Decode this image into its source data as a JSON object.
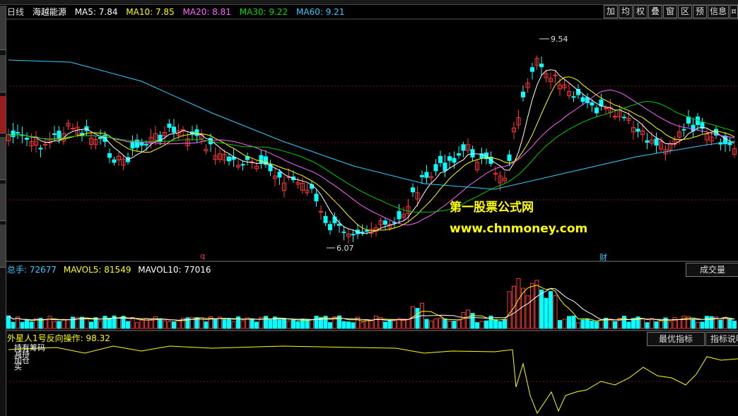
{
  "header": {
    "period": "日线",
    "stock_name": "海越能源",
    "ma5": "MA5: 7.84",
    "ma10": "MA10: 7.85",
    "ma20": "MA20: 8.81",
    "ma30": "MA30: 9.22",
    "ma60": "MA60: 9.21"
  },
  "toolbar_buttons": [
    "加",
    "均",
    "权",
    "叠",
    "窗",
    "区",
    "预",
    "信息",
    "¤"
  ],
  "price_panel": {
    "high_label": "9.54",
    "low_label": "6.07",
    "marker_q": "q",
    "marker_cai": "财",
    "watermark_cn": "第一股票公式网",
    "watermark_url": "www.chnmoney.com"
  },
  "volume_panel": {
    "total": "总手: 72677",
    "mavol5": "MAVOL5: 81549",
    "mavol10": "MAVOL10: 77016",
    "button": "成交量"
  },
  "indicator_panel": {
    "title": "外星人1号反向操作: 98.32",
    "best_button": "最优指标",
    "help_button": "指标说明",
    "legend_lines": [
      "持有筹码",
      "减持",
      "加仓",
      "买"
    ]
  },
  "colors": {
    "ma5": "#ffffff",
    "ma10": "#ffff00",
    "ma20": "#ff66ff",
    "ma30": "#00cc00",
    "ma60": "#33ccff",
    "up": "#ff3333",
    "down": "#00ffff",
    "indicator": "#ffff00"
  }
}
